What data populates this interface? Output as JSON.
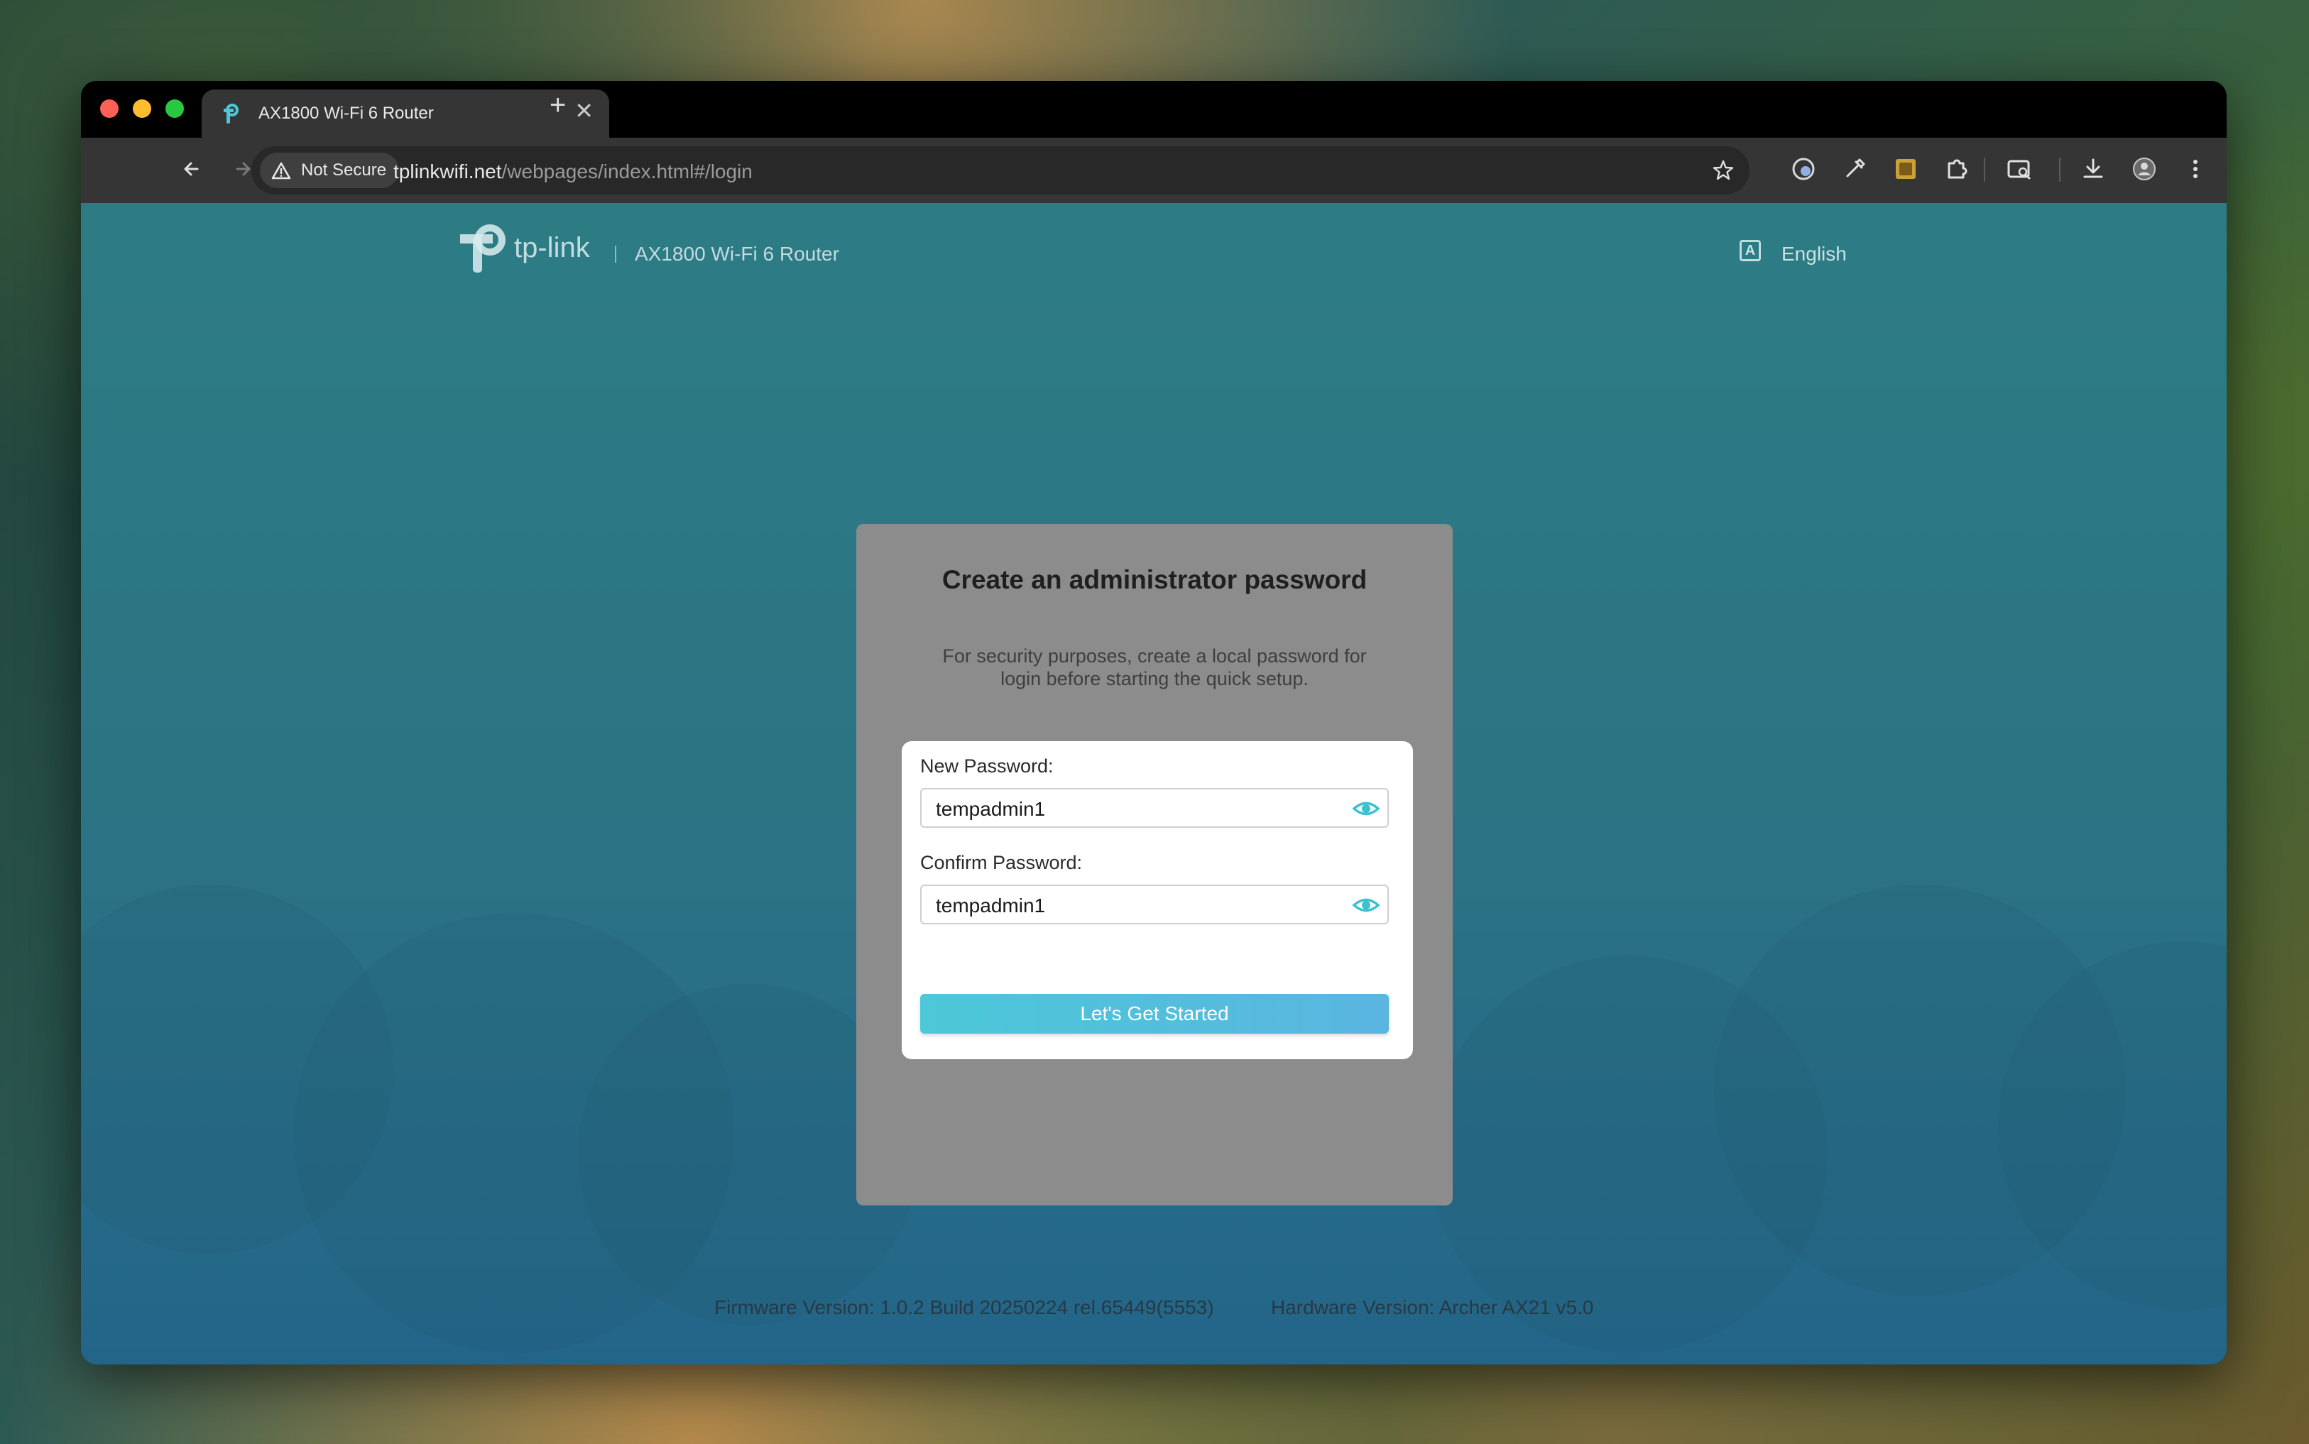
{
  "browser": {
    "tab": {
      "title": "AX1800 Wi-Fi 6 Router",
      "close": "✕"
    },
    "new_tab": "+",
    "security_chip": "Not Secure",
    "url_host": "tplinkwifi.net",
    "url_path": "/webpages/index.html#/login"
  },
  "header": {
    "logo_text": "tp-link",
    "model": "AX1800 Wi-Fi 6 Router",
    "language_icon": "A",
    "language": "English"
  },
  "card": {
    "title": "Create an administrator password",
    "description": "For security purposes, create a local password for login before starting the quick setup.",
    "new_password_label": "New Password:",
    "new_password_value": "tempadmin1",
    "confirm_password_label": "Confirm Password:",
    "confirm_password_value": "tempadmin1",
    "submit_label": "Let's Get Started"
  },
  "footer": {
    "firmware": "Firmware Version: 1.0.2 Build 20250224 rel.65449(5553)",
    "hardware": "Hardware Version: Archer AX21 v5.0"
  },
  "colors": {
    "accent": "#4cc8d8",
    "page_background": "#2b7384",
    "card_background": "#8c8c8c"
  }
}
